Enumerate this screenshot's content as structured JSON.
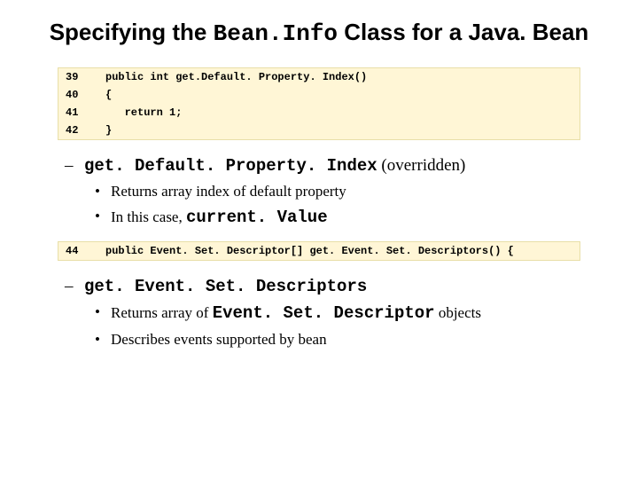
{
  "title_pre": "Specifying the ",
  "title_mono": "Bean.Info",
  "title_post": " Class for a Java. Bean",
  "code1": {
    "rows": [
      {
        "ln": "39",
        "code": "public int get.Default. Property. Index()"
      },
      {
        "ln": "40",
        "code": "{"
      },
      {
        "ln": "41",
        "code": "   return 1;"
      },
      {
        "ln": "42",
        "code": "}"
      }
    ]
  },
  "section1": {
    "heading_mono": "get. Default. Property. Index",
    "heading_plain": " (overridden)",
    "sub": [
      "Returns array index of default property",
      "In this case, "
    ],
    "sub2_mono": "current. Value"
  },
  "code2": {
    "rows": [
      {
        "ln": "44",
        "code": "public Event. Set. Descriptor[] get. Event. Set. Descriptors() {"
      }
    ]
  },
  "section2": {
    "heading_mono": "get. Event. Set. Descriptors",
    "sub": [
      {
        "pre": "Returns array of ",
        "mono": "Event. Set. Descriptor",
        "post": " objects"
      },
      {
        "pre": "Describes events supported by bean",
        "mono": "",
        "post": ""
      }
    ]
  }
}
